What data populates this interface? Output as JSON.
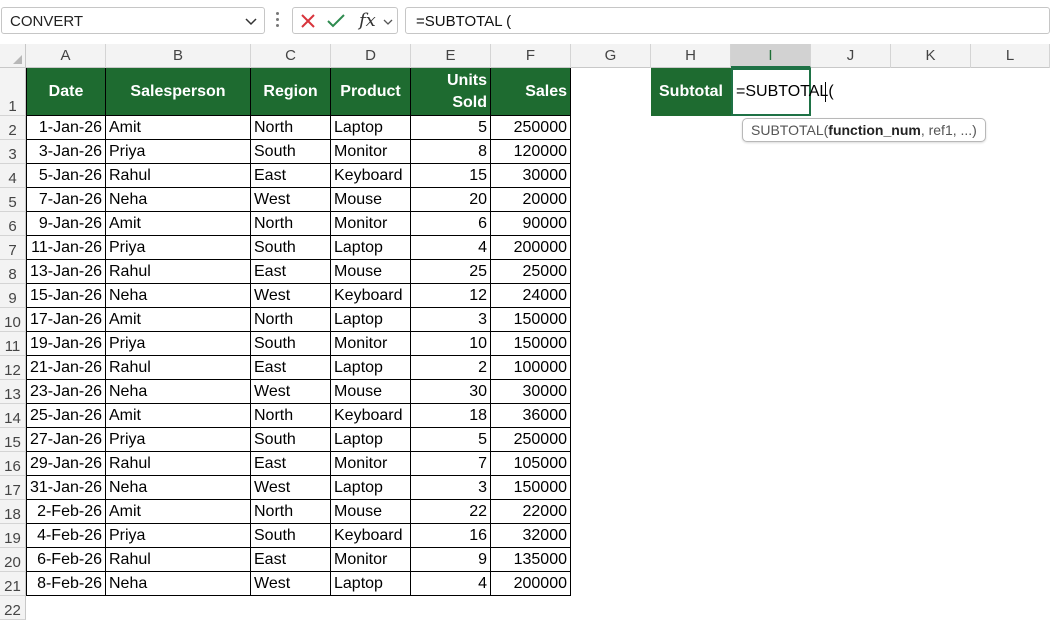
{
  "namebox": {
    "value": "CONVERT"
  },
  "formula_bar": {
    "value": "=SUBTOTAL ("
  },
  "columns": [
    "A",
    "B",
    "C",
    "D",
    "E",
    "F",
    "G",
    "H",
    "I",
    "J",
    "K",
    "L"
  ],
  "rows": [
    "1",
    "2",
    "3",
    "4",
    "5",
    "6",
    "7",
    "8",
    "9",
    "10",
    "11",
    "12",
    "13",
    "14",
    "15",
    "16",
    "17",
    "18",
    "19",
    "20",
    "21",
    "22"
  ],
  "table": {
    "headers": {
      "date": "Date",
      "salesperson": "Salesperson",
      "region": "Region",
      "product": "Product",
      "units_line1": "Units",
      "units_line2": "Sold",
      "sales": "Sales"
    },
    "data": [
      [
        "1-Jan-26",
        "Amit",
        "North",
        "Laptop",
        "5",
        "250000"
      ],
      [
        "3-Jan-26",
        "Priya",
        "South",
        "Monitor",
        "8",
        "120000"
      ],
      [
        "5-Jan-26",
        "Rahul",
        "East",
        "Keyboard",
        "15",
        "30000"
      ],
      [
        "7-Jan-26",
        "Neha",
        "West",
        "Mouse",
        "20",
        "20000"
      ],
      [
        "9-Jan-26",
        "Amit",
        "North",
        "Monitor",
        "6",
        "90000"
      ],
      [
        "11-Jan-26",
        "Priya",
        "South",
        "Laptop",
        "4",
        "200000"
      ],
      [
        "13-Jan-26",
        "Rahul",
        "East",
        "Mouse",
        "25",
        "25000"
      ],
      [
        "15-Jan-26",
        "Neha",
        "West",
        "Keyboard",
        "12",
        "24000"
      ],
      [
        "17-Jan-26",
        "Amit",
        "North",
        "Laptop",
        "3",
        "150000"
      ],
      [
        "19-Jan-26",
        "Priya",
        "South",
        "Monitor",
        "10",
        "150000"
      ],
      [
        "21-Jan-26",
        "Rahul",
        "East",
        "Laptop",
        "2",
        "100000"
      ],
      [
        "23-Jan-26",
        "Neha",
        "West",
        "Mouse",
        "30",
        "30000"
      ],
      [
        "25-Jan-26",
        "Amit",
        "North",
        "Keyboard",
        "18",
        "36000"
      ],
      [
        "27-Jan-26",
        "Priya",
        "South",
        "Laptop",
        "5",
        "250000"
      ],
      [
        "29-Jan-26",
        "Rahul",
        "East",
        "Monitor",
        "7",
        "105000"
      ],
      [
        "31-Jan-26",
        "Neha",
        "West",
        "Laptop",
        "3",
        "150000"
      ],
      [
        "2-Feb-26",
        "Amit",
        "North",
        "Mouse",
        "22",
        "22000"
      ],
      [
        "4-Feb-26",
        "Priya",
        "South",
        "Keyboard",
        "16",
        "32000"
      ],
      [
        "6-Feb-26",
        "Rahul",
        "East",
        "Monitor",
        "9",
        "135000"
      ],
      [
        "8-Feb-26",
        "Neha",
        "West",
        "Laptop",
        "4",
        "200000"
      ]
    ]
  },
  "subtotal": {
    "label": "Subtotal",
    "edit_value": "=SUBTOTAL("
  },
  "tooltip": {
    "fn": "SUBTOTAL(",
    "arg_bold": "function_num",
    "rest": ", ref1, ...)"
  },
  "colors": {
    "header_green": "#1e6b30",
    "accent": "#1e7145"
  }
}
